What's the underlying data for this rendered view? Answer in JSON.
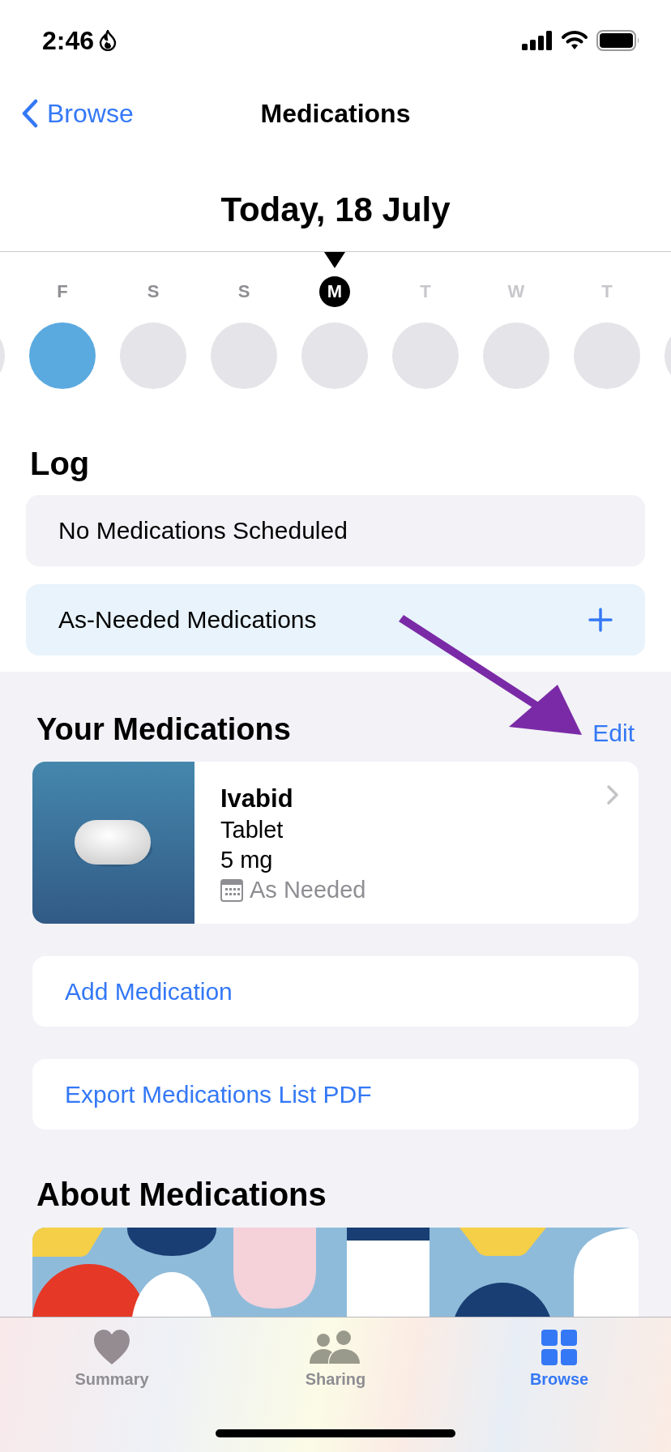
{
  "status_bar": {
    "time": "2:46"
  },
  "nav": {
    "back": "Browse",
    "title": "Medications"
  },
  "date_heading": "Today, 18 July",
  "days": [
    {
      "letter": "F",
      "selected": false,
      "future": false,
      "logged": true
    },
    {
      "letter": "S",
      "selected": false,
      "future": false,
      "logged": false
    },
    {
      "letter": "S",
      "selected": false,
      "future": false,
      "logged": false
    },
    {
      "letter": "M",
      "selected": true,
      "future": false,
      "logged": false
    },
    {
      "letter": "T",
      "selected": false,
      "future": true,
      "logged": false
    },
    {
      "letter": "W",
      "selected": false,
      "future": true,
      "logged": false
    },
    {
      "letter": "T",
      "selected": false,
      "future": true,
      "logged": false
    }
  ],
  "log": {
    "title": "Log",
    "rows": [
      {
        "label": "No Medications Scheduled",
        "kind": "info"
      },
      {
        "label": "As-Needed Medications",
        "kind": "add"
      }
    ]
  },
  "your_medications": {
    "title": "Your Medications",
    "edit": "Edit",
    "items": [
      {
        "name": "Ivabid",
        "form": "Tablet",
        "dose": "5 mg",
        "schedule": "As Needed"
      }
    ]
  },
  "actions": [
    "Add Medication",
    "Export Medications List PDF"
  ],
  "about": {
    "title": "About Medications"
  },
  "tabs": [
    {
      "label": "Summary",
      "kind": "heart",
      "selected": false
    },
    {
      "label": "Sharing",
      "kind": "people",
      "selected": false
    },
    {
      "label": "Browse",
      "kind": "grid",
      "selected": true
    }
  ]
}
